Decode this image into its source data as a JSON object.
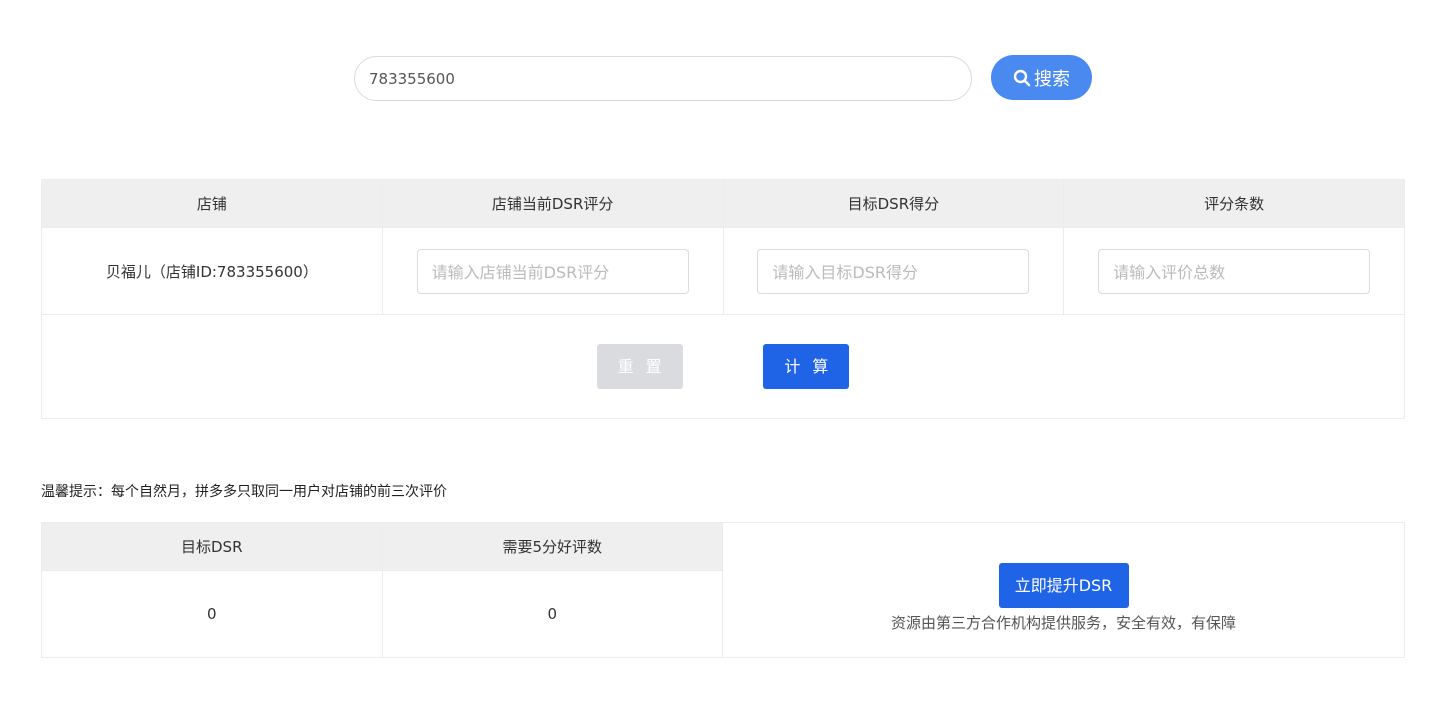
{
  "search": {
    "value": "783355600",
    "button": "搜索",
    "icon": "search-icon"
  },
  "calc_table": {
    "headers": [
      "店铺",
      "店铺当前DSR评分",
      "目标DSR得分",
      "评分条数"
    ],
    "shop": "贝福儿（店铺ID:783355600）",
    "placeholders": [
      "请输入店铺当前DSR评分",
      "请输入目标DSR得分",
      "请输入评价总数"
    ],
    "reset": "重置",
    "calculate": "计算"
  },
  "tip": "温馨提示：每个自然月，拼多多只取同一用户对店铺的前三次评价",
  "result_table": {
    "headers": [
      "目标DSR",
      "需要5分好评数"
    ],
    "values": [
      "0",
      "0"
    ]
  },
  "promo": {
    "button": "立即提升DSR",
    "note": "资源由第三方合作机构提供服务，安全有效，有保障"
  }
}
